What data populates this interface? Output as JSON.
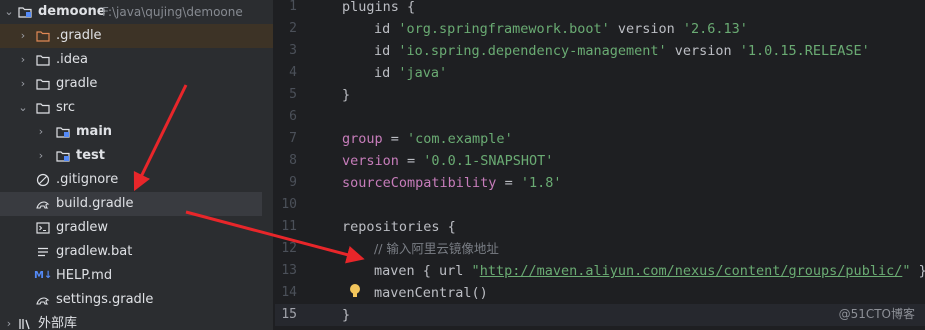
{
  "project": {
    "name": "demoone",
    "path": "F:\\java\\qujing\\demoone"
  },
  "tree": {
    "gradle_dot": ".gradle",
    "idea": ".idea",
    "gradle": "gradle",
    "src": "src",
    "main": "main",
    "test": "test",
    "gitignore": ".gitignore",
    "build_gradle": "build.gradle",
    "gradlew": "gradlew",
    "gradlew_bat": "gradlew.bat",
    "help_md": "HELP.md",
    "settings_gradle": "settings.gradle",
    "external_libs": "外部库"
  },
  "editor": {
    "line_numbers": [
      "1",
      "2",
      "3",
      "4",
      "5",
      "6",
      "7",
      "8",
      "9",
      "10",
      "11",
      "12",
      "13",
      "14",
      "15"
    ],
    "l1": "plugins {",
    "l2_id": "id ",
    "l2_s": "'org.springframework.boot'",
    "l2_v": " version ",
    "l2_s2": "'2.6.13'",
    "l3_id": "id ",
    "l3_s": "'io.spring.dependency-management'",
    "l3_v": " version ",
    "l3_s2": "'1.0.15.RELEASE'",
    "l4_id": "id ",
    "l4_s": "'java'",
    "l5": "}",
    "l7_k": "group",
    "l7_eq": " = ",
    "l7_s": "'com.example'",
    "l8_k": "version",
    "l8_eq": " = ",
    "l8_s": "'0.0.1-SNAPSHOT'",
    "l9_k": "sourceCompatibility",
    "l9_eq": " = ",
    "l9_s": "'1.8'",
    "l11": "repositories {",
    "l12": "// 输入阿里云镜像地址",
    "l13_a": "maven { url ",
    "l13_q1": "\"",
    "l13_url": "http://maven.aliyun.com/nexus/content/groups/public/",
    "l13_q2": "\"",
    "l13_b": " }",
    "l14": "mavenCentral()",
    "l15": "}"
  },
  "watermark": "@51CTO博客",
  "colors": {
    "arrow": "#e8262a",
    "string": "#6aab73",
    "keyword": "#c77dbb",
    "comment": "#7a7e85"
  }
}
